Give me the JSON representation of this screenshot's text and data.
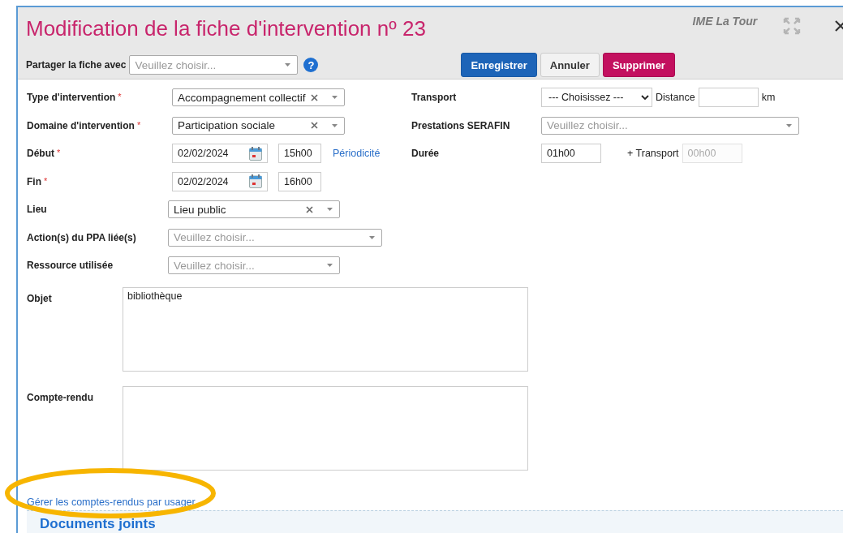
{
  "dialog": {
    "title": "Modification de la fiche d'intervention nº 23",
    "organisation": "IME La Tour"
  },
  "share": {
    "label": "Partager la fiche avec",
    "placeholder": "Veuillez choisir...",
    "help": "?"
  },
  "buttons": [
    {
      "label": "Enregistrer",
      "kind": "primary"
    },
    {
      "label": "Annuler",
      "kind": "default"
    },
    {
      "label": "Supprimer",
      "kind": "danger"
    }
  ],
  "rows": [
    {
      "label": "Type d'intervention",
      "required_mark": "*",
      "controls": [
        {
          "kind": "select",
          "value": "Accompagnement collectif",
          "clearable": true
        }
      ],
      "right": {
        "label": "Transport",
        "controls": [
          {
            "kind": "native_select",
            "value": "--- Choisissez ---"
          },
          {
            "kind": "text",
            "text": "Distance"
          },
          {
            "kind": "input"
          },
          {
            "kind": "text",
            "text": "km"
          }
        ]
      }
    },
    {
      "label": "Domaine d'intervention",
      "required_mark": "*",
      "controls": [
        {
          "kind": "select",
          "value": "Participation sociale",
          "clearable": true
        }
      ],
      "right": {
        "label": "Prestations SERAFIN",
        "controls": [
          {
            "kind": "select",
            "placeholder": "Veuillez choisir...",
            "clearable": false
          }
        ]
      }
    },
    {
      "label": "Début",
      "required_mark": "*",
      "controls": [
        {
          "kind": "date",
          "value": "02/02/2024"
        },
        {
          "kind": "time",
          "value": "15h00"
        },
        {
          "kind": "link",
          "text": "Périodicité"
        }
      ],
      "right": {
        "label": "Durée",
        "controls": [
          {
            "kind": "input",
            "value": "01h00"
          },
          {
            "kind": "text",
            "text": "+ Transport"
          },
          {
            "kind": "input",
            "placeholder": "00h00",
            "disabled": true
          }
        ]
      }
    },
    {
      "label": "Fin",
      "required_mark": "*",
      "controls": [
        {
          "kind": "date",
          "value": "02/02/2024"
        },
        {
          "kind": "time",
          "value": "16h00"
        }
      ]
    },
    {
      "label": "Lieu",
      "controls": [
        {
          "kind": "select",
          "value": "Lieu public",
          "clearable": true
        }
      ]
    },
    {
      "label": "Action(s) du PPA liée(s)",
      "controls": [
        {
          "kind": "select",
          "placeholder": "Veuillez choisir...",
          "clearable": false
        }
      ]
    },
    {
      "label": "Ressource utilisée",
      "controls": [
        {
          "kind": "select",
          "placeholder": "Veuillez choisir...",
          "clearable": false
        }
      ]
    }
  ],
  "textareas": [
    {
      "label": "Objet",
      "value": "bibliothèque"
    },
    {
      "label": "Compte-rendu"
    }
  ],
  "link": "Gérer les comptes-rendus par usager",
  "section": {
    "title": "Documents joints"
  }
}
